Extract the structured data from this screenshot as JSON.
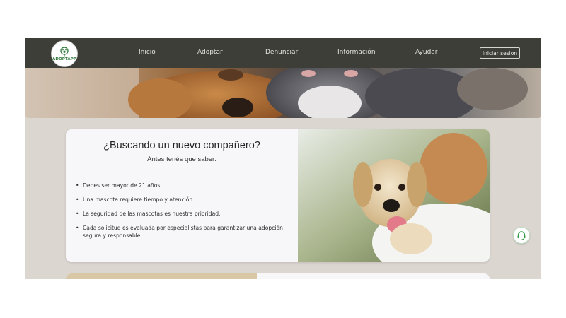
{
  "brand": {
    "logo_text": "ADOPTAPP",
    "accent": "#2f7a3a"
  },
  "nav": {
    "items": [
      {
        "label": "Inicio"
      },
      {
        "label": "Adoptar"
      },
      {
        "label": "Denunciar"
      },
      {
        "label": "Información"
      },
      {
        "label": "Ayudar"
      }
    ],
    "login_label": "Iniciar sesion"
  },
  "hero_card": {
    "title": "¿Buscando un nuevo compañero?",
    "subtitle": "Antes tenés que saber:",
    "requirements": [
      "Debes ser mayor de 21 años.",
      "Una mascota requiere tiempo y atención.",
      "La seguridad de las mascotas es nuestra prioridad.",
      "Cada solicitud es evaluada por especialistas para garantizar una adopción segura y responsable."
    ]
  },
  "support": {
    "icon": "headset-icon"
  },
  "colors": {
    "navbar": "#3e3e38",
    "page_bg": "#dcd6d1",
    "divider": "#9cd3a0"
  }
}
